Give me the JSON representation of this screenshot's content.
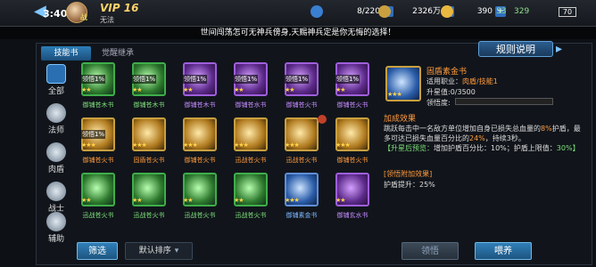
{
  "header": {
    "clock": "3:40",
    "vip_label": "VIP",
    "vip_level": "16",
    "vip_sub": "无法",
    "avatar_badge": "战",
    "resources": [
      {
        "value": "8/220",
        "icon": "stamina-icon",
        "color": "#3a7fd0"
      },
      {
        "value": "2326万",
        "icon": "coin-icon",
        "color": "#c9a040"
      },
      {
        "value": "390",
        "icon": "crown-icon",
        "color": "#e8b840"
      }
    ],
    "wifi": "329",
    "signal": "53",
    "battery": "70"
  },
  "marquee": "世间闯荡怎可无神兵傍身,天赐神兵定是你无悔的选择！",
  "tabs": [
    {
      "label": "技能书",
      "active": true
    },
    {
      "label": "觉醒继承",
      "active": false
    }
  ],
  "rules_button": "规则说明",
  "sidebar": [
    {
      "label": "全部",
      "icon": "all-icon",
      "active": true
    },
    {
      "label": "法师",
      "icon": "mage-icon",
      "active": false
    },
    {
      "label": "肉盾",
      "icon": "tank-icon",
      "active": false
    },
    {
      "label": "战士",
      "icon": "warrior-icon",
      "active": false
    },
    {
      "label": "辅助",
      "icon": "support-icon",
      "active": false
    }
  ],
  "cards": [
    {
      "name": "御铺苍木书",
      "color": "green",
      "stars": "★★",
      "tag": "领悟1%"
    },
    {
      "name": "御铺苍木书",
      "color": "green",
      "stars": "★★",
      "tag": "领悟1%"
    },
    {
      "name": "御铺苍木书",
      "color": "purple",
      "stars": "★★",
      "tag": "领悟1%"
    },
    {
      "name": "御铺苍水书",
      "color": "purple",
      "stars": "★★",
      "tag": "领悟1%"
    },
    {
      "name": "御铺苍火书",
      "color": "purple",
      "stars": "★★",
      "tag": "领悟1%"
    },
    {
      "name": "御铺苍火书",
      "color": "purple",
      "stars": "★★",
      "tag": "领悟1%"
    },
    {
      "name": "御铺苍火书",
      "color": "orange",
      "stars": "★★★",
      "tag": "领悟1%"
    },
    {
      "name": "固盾苍火书",
      "color": "orange",
      "stars": "★★★",
      "tag": ""
    },
    {
      "name": "御铺苍火书",
      "color": "orange",
      "stars": "★★★",
      "tag": ""
    },
    {
      "name": "迅战苍火书",
      "color": "orange",
      "stars": "★★★",
      "tag": ""
    },
    {
      "name": "迅战苍火书",
      "color": "orange",
      "stars": "★★★",
      "tag": "",
      "badge": true
    },
    {
      "name": "御铺苍火书",
      "color": "orange",
      "stars": "★★★",
      "tag": ""
    },
    {
      "name": "迅战苍火书",
      "color": "green",
      "stars": "★★",
      "tag": ""
    },
    {
      "name": "迅战苍火书",
      "color": "green",
      "stars": "★★",
      "tag": ""
    },
    {
      "name": "迅战苍火书",
      "color": "green",
      "stars": "★★",
      "tag": ""
    },
    {
      "name": "迅战苍火书",
      "color": "green",
      "stars": "★★",
      "tag": ""
    },
    {
      "name": "御铺素金书",
      "color": "blue",
      "stars": "★★★",
      "tag": ""
    },
    {
      "name": "御铺玄水书",
      "color": "purple",
      "stars": "★★",
      "tag": ""
    }
  ],
  "detail": {
    "title": "固盾素金书",
    "stars": "★★★",
    "job_label": "适用职业：",
    "job_value": "肉盾/技能1",
    "upgrade_label": "升星值:",
    "upgrade_value": "0/3500",
    "lead_label": "领悟度:",
    "lead_fraction": 0,
    "effect_title": "加成效果",
    "effect_text_1": "跳跃每击中一名敌方单位增加自身已损失总血量的",
    "effect_hl_1": "8%",
    "effect_text_2": "护盾，最多可达已损失血量百分比的",
    "effect_hl_2": "24%",
    "effect_text_3": "，持续3秒。",
    "upgrade_preview_label": "【升星后预览：",
    "upgrade_preview_text": "增加护盾百分比：10%；护盾上限值：",
    "upgrade_preview_end": "30%】",
    "lead_bonus_title": "[领悟附加效果]",
    "lead_bonus_text": "护盾提升：25%"
  },
  "bottom": {
    "filter": "筛选",
    "sort": "默认排序",
    "lead": "领悟",
    "feed": "喂养"
  }
}
